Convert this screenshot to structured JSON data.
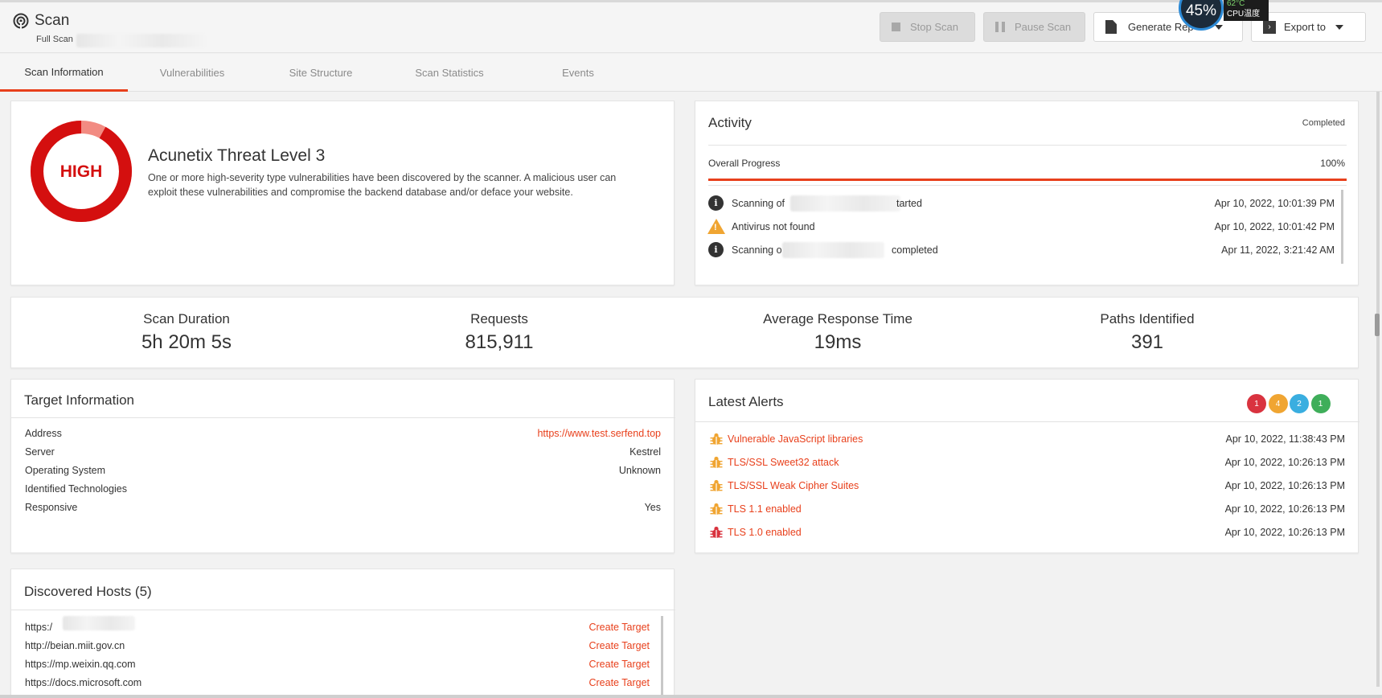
{
  "header": {
    "title": "Scan",
    "subtitle": "Full Scan",
    "buttons": {
      "stop": "Stop Scan",
      "pause": "Pause Scan",
      "generate": "Generate Rep",
      "export": "Export to"
    },
    "cpu": {
      "percent": "45%",
      "temp": "62°C",
      "label": "CPU温度"
    }
  },
  "tabs": [
    "Scan Information",
    "Vulnerabilities",
    "Site Structure",
    "Scan Statistics",
    "Events"
  ],
  "threat": {
    "level_word": "HIGH",
    "title": "Acunetix Threat Level 3",
    "description": "One or more high-severity type vulnerabilities have been discovered by the scanner. A malicious user can exploit these vulnerabilities and compromise the backend database and/or deface your website.",
    "ring_fraction": 0.92
  },
  "activity": {
    "title": "Activity",
    "status": "Completed",
    "progress_label": "Overall Progress",
    "progress_value": "100%",
    "events": [
      {
        "icon": "info-icon",
        "text_a": "Scanning of",
        "text_b": "tarted",
        "time": "Apr 10, 2022, 10:01:39 PM"
      },
      {
        "icon": "warning-icon",
        "text_a": "Antivirus not found",
        "text_b": "",
        "time": "Apr 10, 2022, 10:01:42 PM"
      },
      {
        "icon": "info-icon",
        "text_a": "Scanning o",
        "text_b": "completed",
        "time": "Apr 11, 2022, 3:21:42 AM"
      }
    ]
  },
  "stats": [
    {
      "label": "Scan Duration",
      "value": "5h 20m 5s"
    },
    {
      "label": "Requests",
      "value": "815,911"
    },
    {
      "label": "Average Response Time",
      "value": "19ms"
    },
    {
      "label": "Paths Identified",
      "value": "391"
    }
  ],
  "target": {
    "title": "Target Information",
    "rows": [
      {
        "label": "Address",
        "value": "https://www.test.serfend.top"
      },
      {
        "label": "Server",
        "value": "Kestrel"
      },
      {
        "label": "Operating System",
        "value": "Unknown"
      },
      {
        "label": "Identified Technologies",
        "value": ""
      },
      {
        "label": "Responsive",
        "value": "Yes"
      }
    ]
  },
  "alerts": {
    "title": "Latest Alerts",
    "badges": [
      {
        "count": "1",
        "color": "#d9333f"
      },
      {
        "count": "4",
        "color": "#f0a532"
      },
      {
        "count": "2",
        "color": "#3aaee0"
      },
      {
        "count": "1",
        "color": "#3fae5a"
      }
    ],
    "items": [
      {
        "name": "Vulnerable JavaScript libraries",
        "time": "Apr 10, 2022, 11:38:43 PM",
        "severity_color": "#f0a532"
      },
      {
        "name": "TLS/SSL Sweet32 attack",
        "time": "Apr 10, 2022, 10:26:13 PM",
        "severity_color": "#f0a532"
      },
      {
        "name": "TLS/SSL Weak Cipher Suites",
        "time": "Apr 10, 2022, 10:26:13 PM",
        "severity_color": "#f0a532"
      },
      {
        "name": "TLS 1.1 enabled",
        "time": "Apr 10, 2022, 10:26:13 PM",
        "severity_color": "#f0a532"
      },
      {
        "name": "TLS 1.0 enabled",
        "time": "Apr 10, 2022, 10:26:13 PM",
        "severity_color": "#d9333f"
      }
    ]
  },
  "hosts": {
    "title": "Discovered Hosts (5)",
    "action": "Create Target",
    "items": [
      "https:/",
      "http://beian.miit.gov.cn",
      "https://mp.weixin.qq.com",
      "https://docs.microsoft.com"
    ]
  },
  "colors": {
    "accent": "#e8401c",
    "high": "#d40f0f"
  }
}
